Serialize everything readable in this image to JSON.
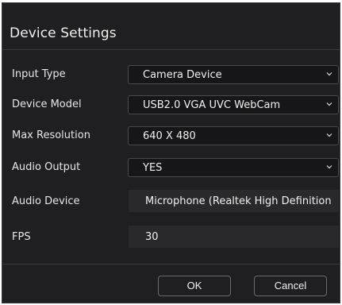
{
  "dialog": {
    "title": "Device Settings"
  },
  "rows": [
    {
      "label": "Input Type",
      "value": "Camera Device",
      "kind": "select"
    },
    {
      "label": "Device Model",
      "value": "USB2.0 VGA UVC WebCam",
      "kind": "select"
    },
    {
      "label": "Max Resolution",
      "value": "640 X 480",
      "kind": "select"
    },
    {
      "label": "Audio Output",
      "value": "YES",
      "kind": "select"
    },
    {
      "label": "Audio Device",
      "value": "Microphone (Realtek High Definition",
      "kind": "field"
    },
    {
      "label": "FPS",
      "value": "30",
      "kind": "field"
    }
  ],
  "buttons": {
    "ok": "OK",
    "cancel": "Cancel"
  },
  "icons": {
    "dropdown": "chevron-down-icon"
  },
  "colors": {
    "background": "#1f1f21",
    "field_background": "#29292b",
    "select_background": "#161618",
    "border": "#4a4a4e",
    "text": "#e8e8e8"
  }
}
